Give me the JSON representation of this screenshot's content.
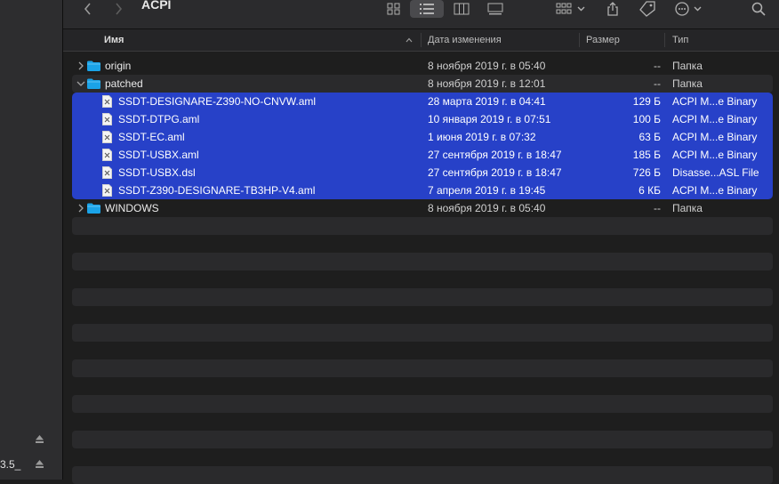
{
  "window": {
    "title": "ACPI"
  },
  "sidebar": {
    "items": [
      {
        "label": ""
      },
      {
        "label": "3.5_"
      }
    ]
  },
  "columns": {
    "name": "Имя",
    "date": "Дата изменения",
    "size": "Размер",
    "kind": "Тип"
  },
  "rows": [
    {
      "name": "origin",
      "date": "8 ноября 2019 г. в 05:40",
      "size": "--",
      "kind": "Папка"
    },
    {
      "name": "patched",
      "date": "8 ноября 2019 г. в 12:01",
      "size": "--",
      "kind": "Папка"
    },
    {
      "name": "SSDT-DESIGNARE-Z390-NO-CNVW.aml",
      "date": "28 марта 2019 г. в 04:41",
      "size": "129 Б",
      "kind": "ACPI M...e Binary"
    },
    {
      "name": "SSDT-DTPG.aml",
      "date": "10 января 2019 г. в 07:51",
      "size": "100 Б",
      "kind": "ACPI M...e Binary"
    },
    {
      "name": "SSDT-EC.aml",
      "date": "1 июня 2019 г. в 07:32",
      "size": "63 Б",
      "kind": "ACPI M...e Binary"
    },
    {
      "name": "SSDT-USBX.aml",
      "date": "27 сентября 2019 г. в 18:47",
      "size": "185 Б",
      "kind": "ACPI M...e Binary"
    },
    {
      "name": "SSDT-USBX.dsl",
      "date": "27 сентября 2019 г. в 18:47",
      "size": "726 Б",
      "kind": "Disasse...ASL File"
    },
    {
      "name": "SSDT-Z390-DESIGNARE-TB3HP-V4.aml",
      "date": "7 апреля 2019 г. в 19:45",
      "size": "6 КБ",
      "kind": "ACPI M...e Binary"
    },
    {
      "name": "WINDOWS",
      "date": "8 ноября 2019 г. в 05:40",
      "size": "--",
      "kind": "Папка"
    }
  ],
  "icons": {
    "back": "chevron-left-icon",
    "forward": "chevron-right-icon",
    "grid": "icon-view-icon",
    "list": "list-view-icon",
    "columns": "column-view-icon",
    "gallery": "gallery-view-icon",
    "group": "group-icon",
    "share": "share-icon",
    "tag": "tag-icon",
    "more": "more-icon",
    "search": "search-icon",
    "folder": "folder-icon",
    "document": "document-icon",
    "eject": "eject-icon"
  },
  "colors": {
    "selection": "#2741c8",
    "folder": "#1aa3e8",
    "background": "#1e1e1e"
  }
}
